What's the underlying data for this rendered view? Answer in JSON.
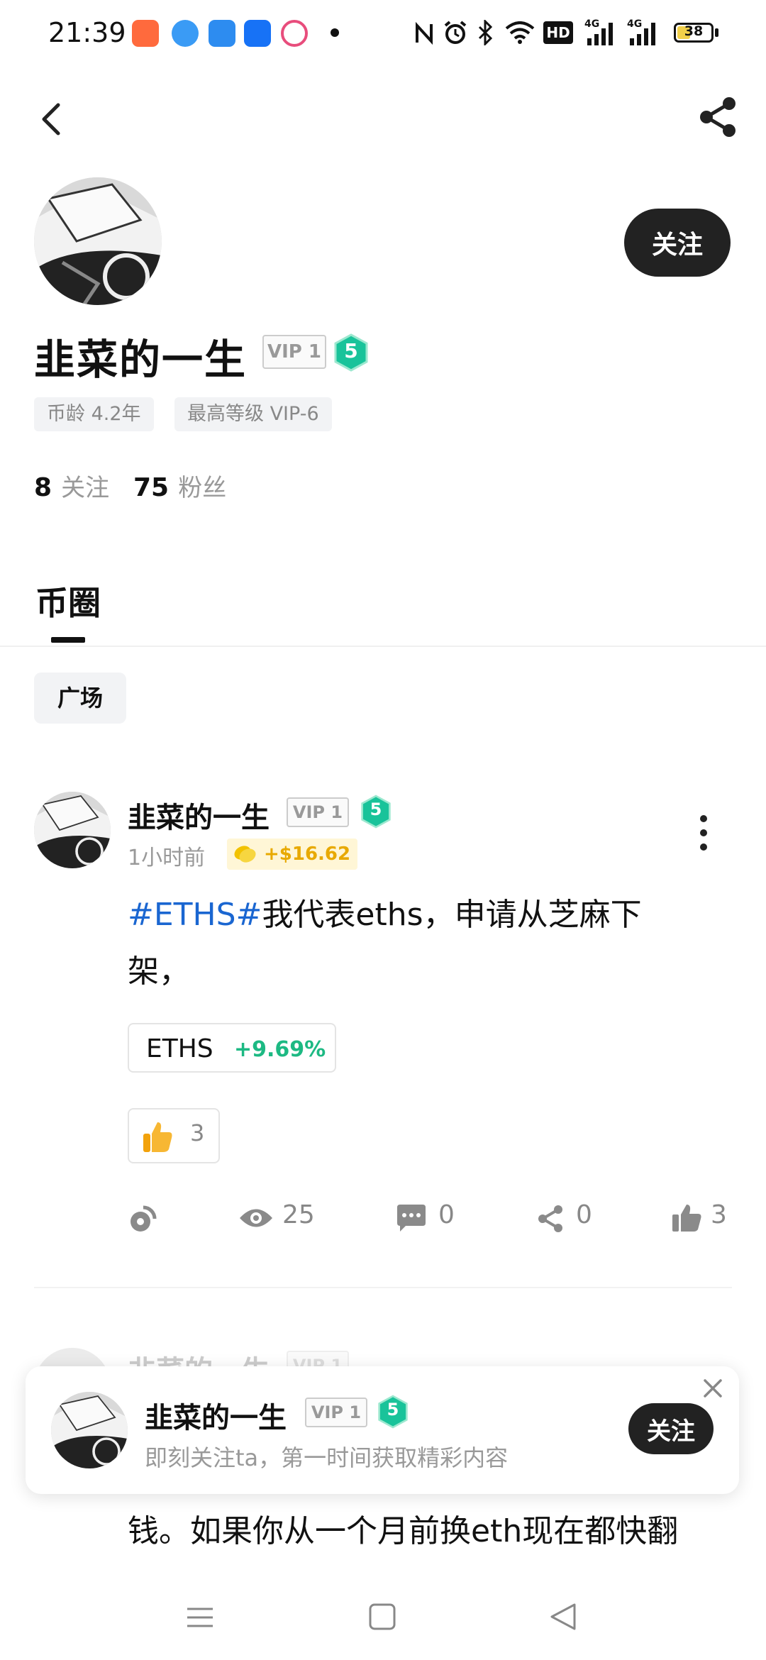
{
  "status_bar": {
    "time": "21:39",
    "battery": "38",
    "icons": [
      "nfc-icon",
      "alarm-icon",
      "bluetooth-icon",
      "wifi-icon",
      "hd-icon",
      "signal-4g-icon",
      "signal-4g-icon"
    ]
  },
  "profile": {
    "name": "韭菜的一生",
    "vip": "VIP 1",
    "level": "5",
    "tags": [
      "币龄 4.2年",
      "最高等级 VIP-6"
    ],
    "following_count": "8",
    "following_label": "关注",
    "followers_count": "75",
    "followers_label": "粉丝",
    "follow_button": "关注"
  },
  "tabs": {
    "active": "币圈"
  },
  "filter_chip": "广场",
  "post": {
    "author": "韭菜的一生",
    "vip": "VIP 1",
    "level": "5",
    "time": "1小时前",
    "tip": "+$16.62",
    "hashtag": "#ETHS#",
    "text_line1": "我代表eths，申请从芝麻下",
    "text_line2": "架，",
    "coin": {
      "name": "ETHS",
      "change": "+9.69%"
    },
    "reaction_count": "3",
    "actions": {
      "views": "25",
      "comments": "0",
      "shares": "0",
      "likes": "3"
    }
  },
  "next_post_peek": {
    "author": "韭菜的一生",
    "vip": "VIP 1"
  },
  "follow_popup": {
    "name": "韭菜的一生",
    "vip": "VIP 1",
    "level": "5",
    "subtitle": "即刻关注ta，第一时间获取精彩内容",
    "button": "关注"
  },
  "bottom_text": "钱。如果你从一个月前换eth现在都快翻",
  "colors": {
    "hashtag": "#1a66d1",
    "positive": "#1db983",
    "level_badge": "#19c39a",
    "tip": "#e8a900"
  }
}
